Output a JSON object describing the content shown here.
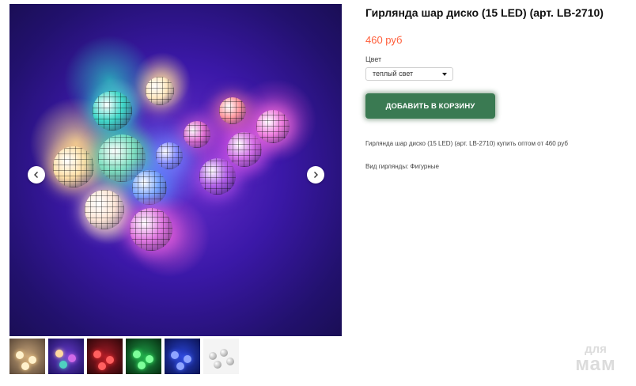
{
  "product": {
    "title": "Гирлянда шар диско (15 LED) (арт. LB-2710)",
    "price": "460 руб",
    "color_label": "Цвет",
    "color_selected": "теплый свет",
    "add_to_cart": "ДОБАВИТЬ В КОРЗИНУ",
    "description": "Гирлянда шар диско (15 LED) (арт. LB-2710) купить оптом от 460 руб",
    "garland_type": "Вид гирлянды: Фигурные"
  },
  "thumbnails": [
    {
      "name": "thumb-warm",
      "bg": "#6b5a48",
      "dot": "#ffd9a0"
    },
    {
      "name": "thumb-multicolor",
      "bg": "#2b1d6e",
      "dot": "#c85fe0"
    },
    {
      "name": "thumb-red",
      "bg": "#3a0a10",
      "dot": "#ff3b3b"
    },
    {
      "name": "thumb-green",
      "bg": "#0c3a1a",
      "dot": "#3cff6a"
    },
    {
      "name": "thumb-blue",
      "bg": "#0a1a5a",
      "dot": "#4a6cff"
    },
    {
      "name": "thumb-silver",
      "bg": "#f2f2f2",
      "dot": "#9a9a9a"
    }
  ],
  "watermark": {
    "line1": "для",
    "line2": "мам"
  },
  "icons": {
    "prev": "chevron-left-icon",
    "next": "chevron-right-icon"
  },
  "colors": {
    "accent": "#ff5e3a",
    "button": "#3a7a52"
  }
}
